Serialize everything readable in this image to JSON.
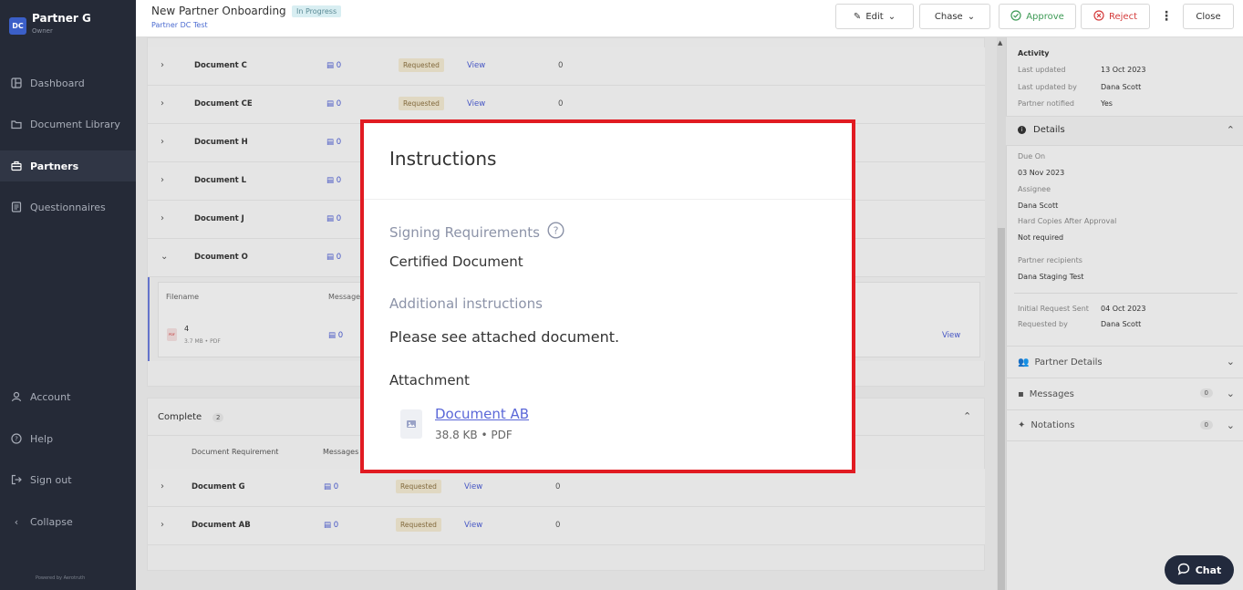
{
  "sidebar": {
    "brand_logo": "DC",
    "brand_name": "Partner G",
    "brand_role": "Owner",
    "nav": [
      {
        "label": "Dashboard",
        "icon": "dashboard-icon"
      },
      {
        "label": "Document Library",
        "icon": "folder-icon"
      },
      {
        "label": "Partners",
        "icon": "briefcase-icon"
      },
      {
        "label": "Questionnaires",
        "icon": "form-icon"
      }
    ],
    "bottom": [
      {
        "label": "Account",
        "icon": "user-icon"
      },
      {
        "label": "Help",
        "icon": "help-icon"
      },
      {
        "label": "Sign out",
        "icon": "signout-icon"
      },
      {
        "label": "Collapse",
        "icon": "chevron-left-icon"
      }
    ],
    "powered_by": "Powered by Aerotruth"
  },
  "header": {
    "title": "New Partner Onboarding",
    "status": "In Progress",
    "subtitle": "Partner DC Test",
    "buttons": {
      "edit": "Edit",
      "chase": "Chase",
      "approve": "Approve",
      "reject": "Reject",
      "close": "Close"
    }
  },
  "requested_rows": [
    {
      "name": "Document C",
      "messages": "0",
      "status": "Requested",
      "view": "View",
      "count": "0"
    },
    {
      "name": "Document CE",
      "messages": "0",
      "status": "Requested",
      "view": "View",
      "count": "0"
    },
    {
      "name": "Document H",
      "messages": "0"
    },
    {
      "name": "Document L",
      "messages": "0"
    },
    {
      "name": "Document J",
      "messages": "0"
    },
    {
      "name": "Dcoument O",
      "messages": "0"
    }
  ],
  "expanded": {
    "col_filename": "Filename",
    "col_messages": "Messages",
    "file_name": "4",
    "file_meta": "3.7 MB • PDF",
    "file_icon": "PDF",
    "messages": "0",
    "view": "View"
  },
  "complete": {
    "label": "Complete",
    "count": "2",
    "col_requirement": "Document Requirement",
    "col_messages": "Messages",
    "rows": [
      {
        "name": "Document G",
        "messages": "0",
        "status": "Requested",
        "view": "View",
        "count": "0"
      },
      {
        "name": "Document AB",
        "messages": "0",
        "status": "Requested",
        "view": "View",
        "count": "0"
      }
    ]
  },
  "right_panel": {
    "activity_title": "Activity",
    "last_updated_label": "Last updated",
    "last_updated": "13 Oct 2023",
    "last_updated_by_label": "Last updated by",
    "last_updated_by": "Dana Scott",
    "partner_notified_label": "Partner notified",
    "partner_notified": "Yes",
    "details_title": "Details",
    "due_on_label": "Due On",
    "due_on": "03 Nov 2023",
    "assignee_label": "Assignee",
    "assignee": "Dana Scott",
    "hard_copies_label": "Hard Copies After Approval",
    "hard_copies": "Not required",
    "recipients_label": "Partner recipients",
    "recipients": "Dana Staging Test",
    "initial_sent_label": "Initial Request Sent",
    "initial_sent": "04 Oct 2023",
    "requested_by_label": "Requested by",
    "requested_by": "Dana Scott",
    "partner_details": "Partner Details",
    "messages": "Messages",
    "messages_count": "0",
    "notations": "Notations",
    "notations_count": "0"
  },
  "modal": {
    "title": "Instructions",
    "signing_label": "Signing Requirements",
    "signing_value": "Certified Document",
    "additional_label": "Additional instructions",
    "additional_value": "Please see attached document.",
    "attachment_label": "Attachment",
    "attachment_name": "Document AB",
    "attachment_meta": "38.8 KB • PDF"
  },
  "chat": {
    "label": "Chat"
  },
  "colors": {
    "accent": "#4a5bd0",
    "highlight_border": "#e11b22",
    "sidebar": "#252a37"
  }
}
